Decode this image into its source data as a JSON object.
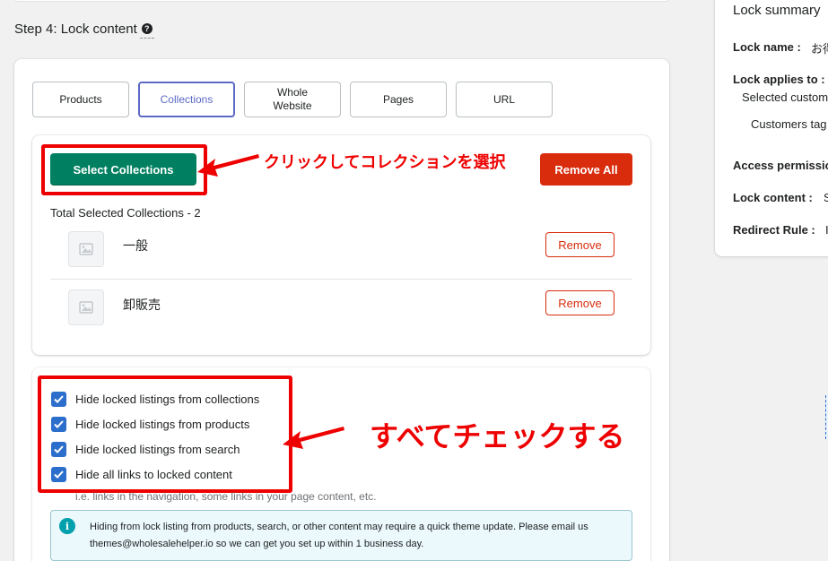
{
  "step": {
    "title": "Step 4: Lock content",
    "help_icon": "?"
  },
  "tabs": [
    {
      "label": "Products",
      "active": false
    },
    {
      "label": "Collections",
      "active": true
    },
    {
      "label": "Whole Website",
      "active": false
    },
    {
      "label": "Pages",
      "active": false
    },
    {
      "label": "URL",
      "active": false
    }
  ],
  "collections": {
    "select_label": "Select Collections",
    "remove_all_label": "Remove All",
    "total_label": "Total Selected Collections - 2",
    "items": [
      {
        "name": "一般",
        "remove_label": "Remove",
        "thumbnail": "image-placeholder-icon"
      },
      {
        "name": "卸販売",
        "remove_label": "Remove",
        "thumbnail": "image-placeholder-icon"
      }
    ]
  },
  "options": {
    "checkboxes": [
      {
        "label": "Hide locked listings from collections",
        "checked": true
      },
      {
        "label": "Hide locked listings from products",
        "checked": true
      },
      {
        "label": "Hide locked listings from search",
        "checked": true
      },
      {
        "label": "Hide all links to locked content",
        "checked": true
      }
    ],
    "helper_text": "i.e. links in the navigation, some links in your page content, etc.",
    "info_icon": "i",
    "info_text": "Hiding from lock listing from products, search, or other content may require a quick theme update. Please email us themes@wholesalehelper.io so we can get you set up within 1 business day."
  },
  "annotations": {
    "select_note": "クリックしてコレクションを選択",
    "check_note": "すべてチェックする",
    "color": "#ee0000"
  },
  "summary": {
    "title": "Lock summary",
    "lock_name_label": "Lock name :",
    "lock_name_value": "お得",
    "applies_label": "Lock applies to :",
    "applies_value": "Selected custom",
    "customers_tag": "Customers tag",
    "access_label": "Access permissio",
    "content_label": "Lock content :",
    "content_value": "S",
    "redirect_label": "Redirect Rule :",
    "redirect_value": "I"
  },
  "colors": {
    "primary_green": "#008060",
    "critical_red": "#d82c0d",
    "active_tab": "#5c6ac4",
    "checkbox_blue": "#2c6ecb"
  }
}
